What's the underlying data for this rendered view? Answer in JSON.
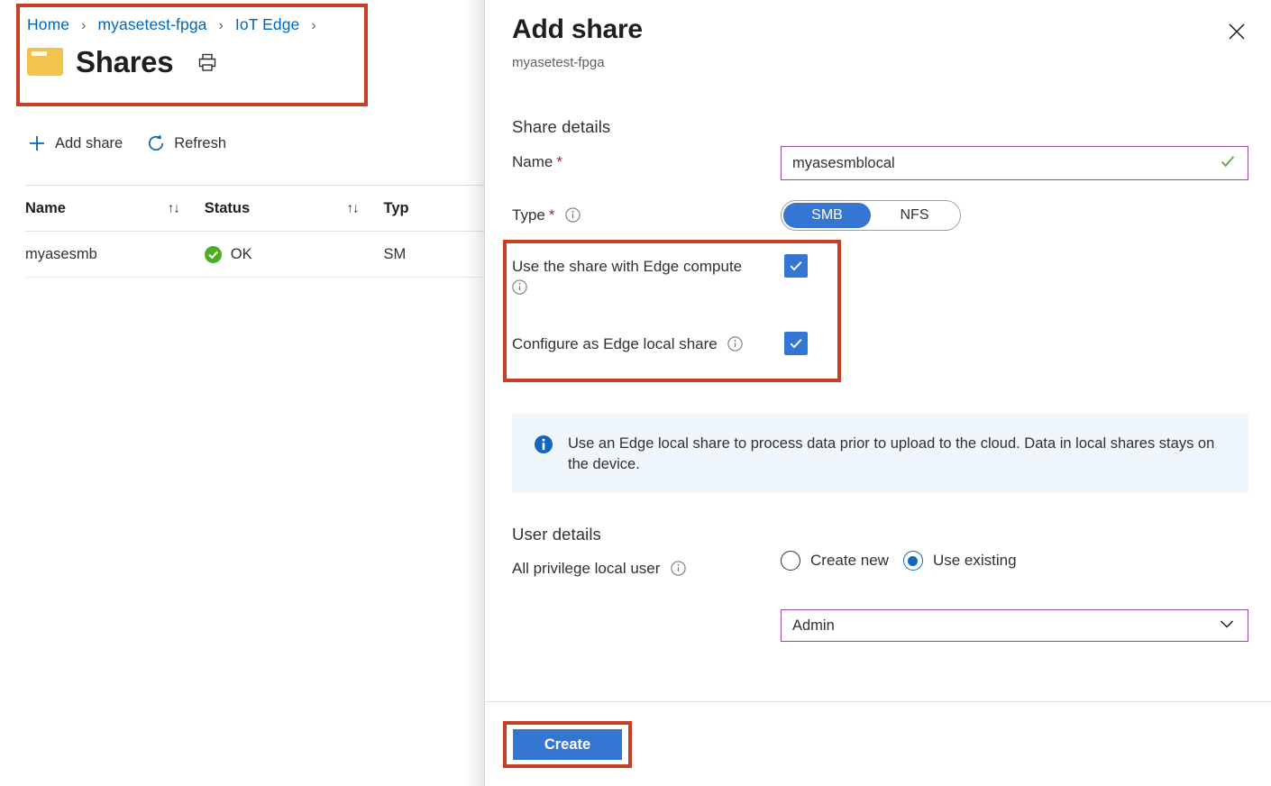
{
  "colors": {
    "accent_blue": "#3576d3",
    "link_blue": "#0067b8",
    "highlight_red": "#c63f26",
    "field_purple": "#8e4a9e",
    "status_green": "#4caf21",
    "banner_bg": "#eff6fc",
    "folder_yellow": "#f2c44d"
  },
  "left_blade": {
    "breadcrumb": {
      "name": "breadcrumb",
      "items": [
        {
          "label": "Home"
        },
        {
          "label": "myasetest-fpga"
        },
        {
          "label": "IoT Edge"
        }
      ],
      "separator": "›",
      "trailing_separator": "›"
    },
    "page_title": "Shares",
    "folder_icon": "folder-icon",
    "print_icon": "printer-icon",
    "commands": [
      {
        "icon": "plus-icon",
        "label": "Add share"
      },
      {
        "icon": "refresh-icon",
        "label": "Refresh"
      }
    ],
    "table": {
      "columns": [
        {
          "label": "Name",
          "sortable": true,
          "sort_glyph": "↑↓"
        },
        {
          "label": "Status",
          "sortable": true,
          "sort_glyph": "↑↓"
        },
        {
          "label": "Typ",
          "sortable": false,
          "sort_glyph": ""
        }
      ],
      "rows": [
        {
          "name": "myasesmb",
          "status": "OK",
          "status_icon": "check-circle-icon",
          "type": "SM"
        }
      ]
    }
  },
  "panel": {
    "title": "Add share",
    "subtitle": "myasetest-fpga",
    "close_icon": "close-icon",
    "share_details": {
      "section_title": "Share details",
      "name": {
        "label": "Name",
        "required_marker": "*",
        "value": "myasesmblocal",
        "placeholder": "",
        "valid_icon": "green-check-icon"
      },
      "type": {
        "label": "Type",
        "required_marker": "*",
        "info_icon": "info-icon",
        "options": [
          "SMB",
          "NFS"
        ],
        "selected": "SMB"
      },
      "checkboxes": [
        {
          "label": "Use the share with Edge compute",
          "info_icon": "info-icon",
          "checked": true,
          "check_glyph": "✓"
        },
        {
          "label": "Configure as Edge local share",
          "info_icon": "info-icon",
          "checked": true,
          "check_glyph": "✓"
        }
      ]
    },
    "banner": {
      "icon": "info-filled-icon",
      "text": "Use an Edge local share to process data prior to upload to the cloud. Data in local shares stays on the device."
    },
    "user_details": {
      "section_title": "User details",
      "field_label": "All privilege local user",
      "info_icon": "info-icon",
      "radios": [
        {
          "label": "Create new",
          "selected": false
        },
        {
          "label": "Use existing",
          "selected": true
        }
      ],
      "select": {
        "value": "Admin",
        "chevron_icon": "chevron-down-icon"
      }
    },
    "footer": {
      "create_label": "Create"
    }
  }
}
